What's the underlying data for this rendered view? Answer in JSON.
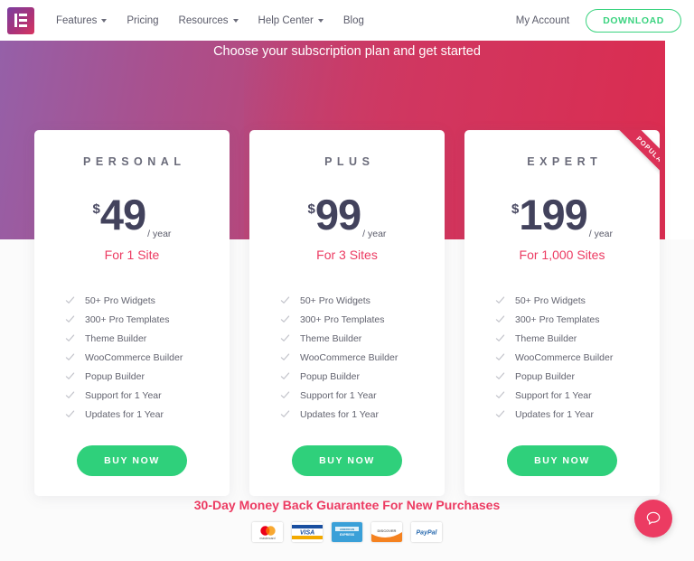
{
  "header": {
    "logo_name": "elementor-logo",
    "nav": [
      {
        "label": "Features",
        "has_caret": true
      },
      {
        "label": "Pricing",
        "has_caret": false
      },
      {
        "label": "Resources",
        "has_caret": true
      },
      {
        "label": "Help Center",
        "has_caret": true
      },
      {
        "label": "Blog",
        "has_caret": false
      }
    ],
    "my_account": "My Account",
    "download": "DOWNLOAD"
  },
  "hero": {
    "title": "Choose your subscription plan and get started"
  },
  "plans": [
    {
      "name": "PERSONAL",
      "currency": "$",
      "amount": "49",
      "period": "/ year",
      "sites": "For 1 Site",
      "popular": false,
      "features": [
        "50+ Pro Widgets",
        "300+ Pro Templates",
        "Theme Builder",
        "WooCommerce Builder",
        "Popup Builder",
        "Support for 1 Year",
        "Updates for 1 Year"
      ],
      "cta": "BUY NOW"
    },
    {
      "name": "PLUS",
      "currency": "$",
      "amount": "99",
      "period": "/ year",
      "sites": "For 3 Sites",
      "popular": false,
      "features": [
        "50+ Pro Widgets",
        "300+ Pro Templates",
        "Theme Builder",
        "WooCommerce Builder",
        "Popup Builder",
        "Support for 1 Year",
        "Updates for 1 Year"
      ],
      "cta": "BUY NOW"
    },
    {
      "name": "EXPERT",
      "currency": "$",
      "amount": "199",
      "period": "/ year",
      "sites": "For 1,000 Sites",
      "popular": true,
      "ribbon": "POPULAR",
      "features": [
        "50+ Pro Widgets",
        "300+ Pro Templates",
        "Theme Builder",
        "WooCommerce Builder",
        "Popup Builder",
        "Support for 1 Year",
        "Updates for 1 Year"
      ],
      "cta": "BUY NOW"
    }
  ],
  "footer": {
    "guarantee": "30-Day Money Back Guarantee For New Purchases",
    "payment_methods": [
      {
        "name": "mastercard",
        "label": "mastercard"
      },
      {
        "name": "visa",
        "label": "VISA"
      },
      {
        "name": "american-express",
        "label": "AMERICAN EXPRESS"
      },
      {
        "name": "discover",
        "label": "DISCOVER"
      },
      {
        "name": "paypal",
        "label": "PayPal"
      }
    ]
  },
  "chat": {
    "name": "help-chat-button"
  },
  "colors": {
    "accent_pink": "#ec3b62",
    "green": "#2fd07b",
    "gradient_start": "#9560a8",
    "gradient_end": "#dc2b4e",
    "price_text": "#42425c"
  }
}
